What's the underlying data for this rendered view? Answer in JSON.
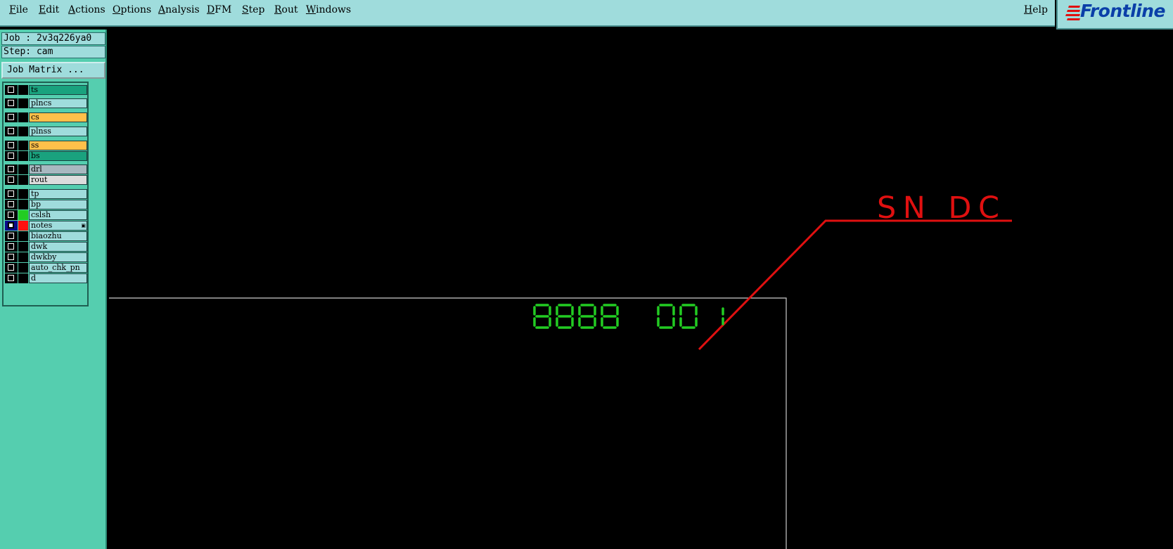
{
  "menubar": {
    "items": [
      "File",
      "Edit",
      "Actions",
      "Options",
      "Analysis",
      "DFM",
      "Step",
      "Rout",
      "Windows"
    ],
    "help": "Help"
  },
  "logo": {
    "text": "Frontline",
    "color": "#0a3fa8",
    "accent": "#e01010"
  },
  "job": {
    "job_label": "Job : 2v3q226ya0",
    "step_label": "Step: cam",
    "matrix_button": "Job Matrix ..."
  },
  "layers": [
    {
      "name": "ts",
      "color": "#1aa27e",
      "swatch": "#000000",
      "checked": false
    },
    {
      "name": "plncs",
      "color": "#9fdcdc",
      "swatch": "#000000",
      "checked": false
    },
    {
      "name": "cs",
      "color": "#ffc04a",
      "swatch": "#000000",
      "checked": false
    },
    {
      "name": "plnss",
      "color": "#9fdcdc",
      "swatch": "#000000",
      "checked": false
    },
    {
      "name": "ss",
      "color": "#ffc04a",
      "swatch": "#000000",
      "checked": false
    },
    {
      "name": "bs",
      "color": "#1aa27e",
      "swatch": "#000000",
      "checked": false
    },
    {
      "name": "drl",
      "color": "#a8b8c0",
      "swatch": "#000000",
      "checked": false
    },
    {
      "name": "rout",
      "color": "#dcdcdc",
      "swatch": "#000000",
      "checked": false
    },
    {
      "name": "tp",
      "color": "#9fdcdc",
      "swatch": "#000000",
      "checked": false
    },
    {
      "name": "bp",
      "color": "#9fdcdc",
      "swatch": "#000000",
      "checked": false
    },
    {
      "name": "cslsh",
      "color": "#9fdcdc",
      "swatch": "#22cc22",
      "checked": false
    },
    {
      "name": "notes",
      "color": "#9fdcdc",
      "swatch": "#ff1010",
      "checked": true,
      "active": true
    },
    {
      "name": "biaozhu",
      "color": "#9fdcdc",
      "swatch": "#000000",
      "checked": false
    },
    {
      "name": "dwk",
      "color": "#9fdcdc",
      "swatch": "#000000",
      "checked": false
    },
    {
      "name": "dwkby",
      "color": "#9fdcdc",
      "swatch": "#000000",
      "checked": false
    },
    {
      "name": "auto_chk_pn",
      "color": "#9fdcdc",
      "swatch": "#000000",
      "checked": false
    },
    {
      "name": "d",
      "color": "#9fdcdc",
      "swatch": "#000000",
      "checked": false
    }
  ],
  "canvas": {
    "annotation_text": "SN DC",
    "annotation_color": "#e01010",
    "digits_color": "#22cc22",
    "outline_color": "#cccccc"
  }
}
